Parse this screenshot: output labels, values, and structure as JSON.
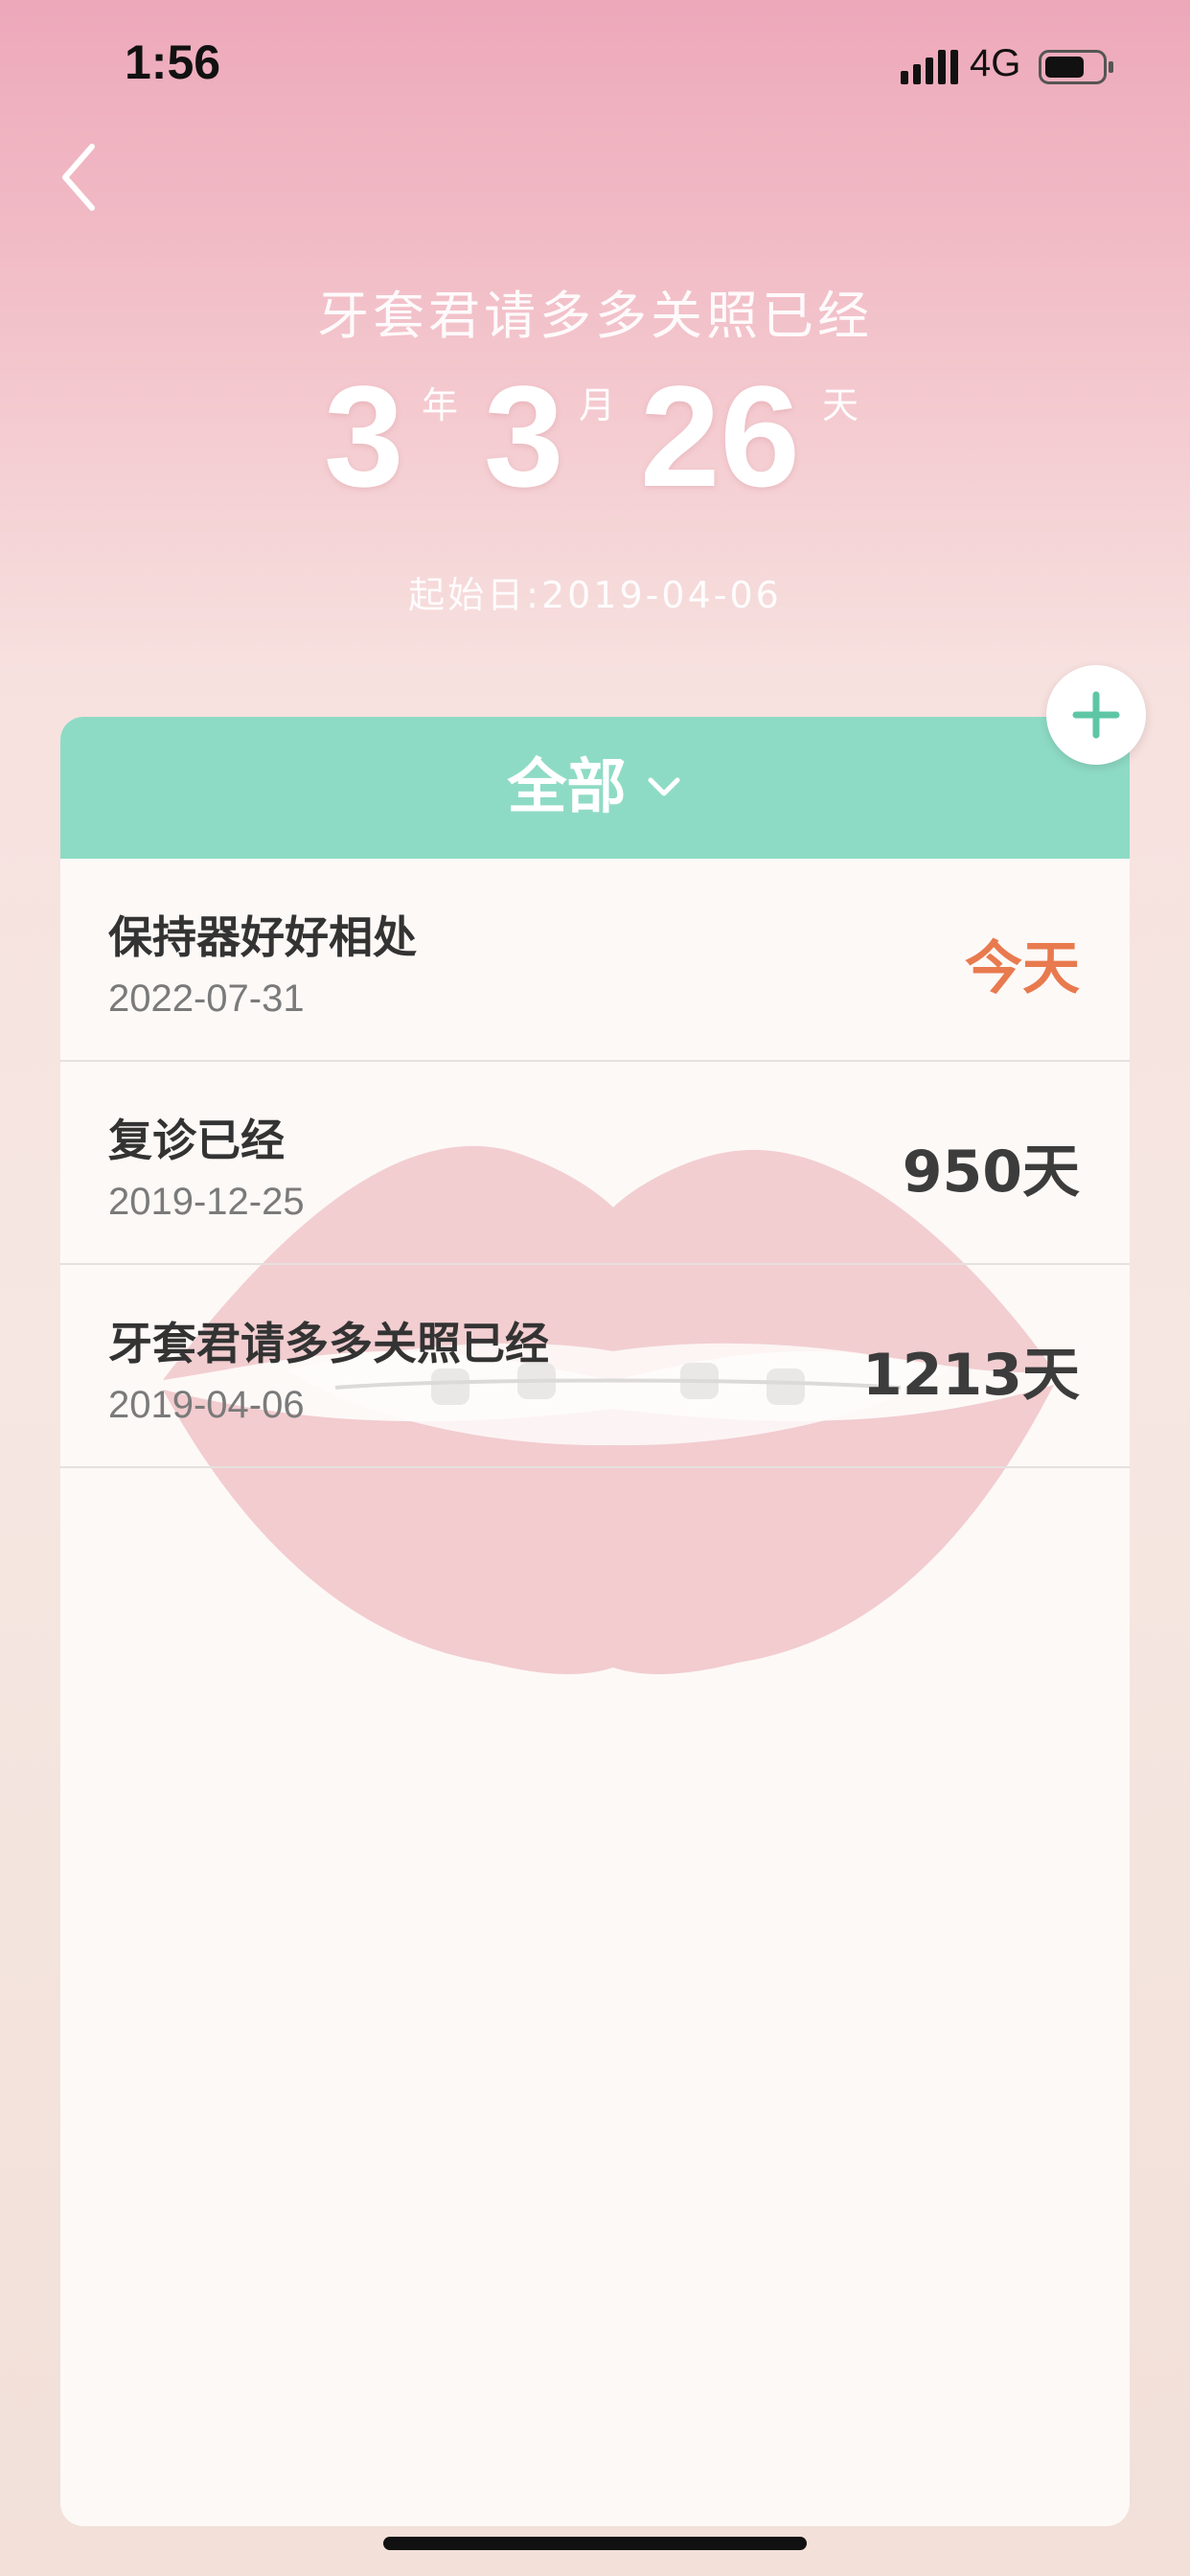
{
  "status_bar": {
    "time": "1:56",
    "network": "4G",
    "icons": [
      "signal-icon",
      "battery-icon"
    ]
  },
  "header": {
    "back_icon": "chevron-left-icon",
    "title": "牙套君请多多关照已经",
    "counter": {
      "years": "3",
      "years_unit": "年",
      "months": "3",
      "months_unit": "月",
      "days": "26",
      "days_unit": "天"
    },
    "start_date": "起始日:2019-04-06"
  },
  "add_button": {
    "icon": "plus-icon"
  },
  "filter": {
    "label": "全部",
    "icon": "chevron-down-icon"
  },
  "list": [
    {
      "title": "保持器好好相处",
      "date": "2022-07-31",
      "value": "今天"
    },
    {
      "title": "复诊已经",
      "date": "2019-12-25",
      "value": "950天"
    },
    {
      "title": "牙套君请多多关照已经",
      "date": "2019-04-06",
      "value": "1213天"
    }
  ],
  "colors": {
    "accent_green": "#8edbc5",
    "today_orange": "#e87a4e",
    "pink_top": "#eda8ba"
  }
}
